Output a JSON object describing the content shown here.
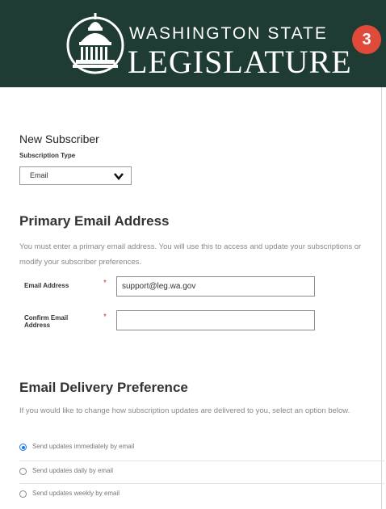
{
  "header": {
    "brand_top": "WASHINGTON STATE",
    "brand_main": "LEGISLATURE",
    "step_number": "3",
    "colors": {
      "background": "#1e3c33",
      "badge": "#e04a3b"
    },
    "logo_icon": "capitol-dome-icon"
  },
  "subscriber": {
    "heading": "New Subscriber",
    "type_label": "Subscription Type",
    "type_value": "Email",
    "type_icon": "chevron-down-icon"
  },
  "primary_email": {
    "heading": "Primary Email Address",
    "description": "You must enter a primary email address. You will use this to access and update your subscriptions or modify your subscriber preferences.",
    "email_label": "Email Address",
    "email_value": "support@leg.wa.gov",
    "confirm_label": "Confirm Email Address",
    "confirm_value": "",
    "required_marker": "*"
  },
  "delivery": {
    "heading": "Email Delivery Preference",
    "description": "If you would like to change how subscription updates are delivered to you, select an option below.",
    "options": [
      {
        "label": "Send updates immediately by email",
        "selected": true
      },
      {
        "label": "Send updates daily by email",
        "selected": false
      },
      {
        "label": "Send updates weekly by email",
        "selected": false
      }
    ]
  }
}
